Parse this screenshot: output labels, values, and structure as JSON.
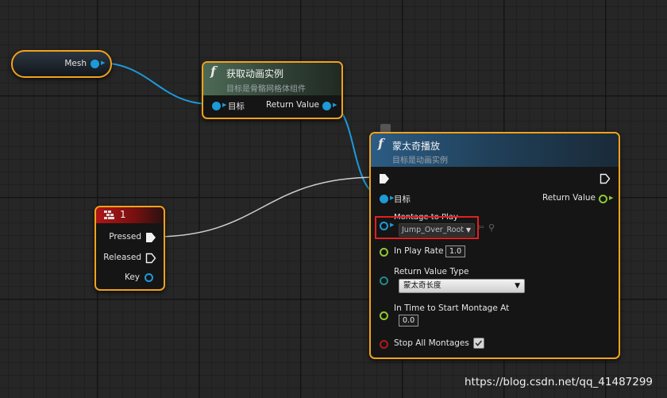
{
  "variable_node": {
    "label": "Mesh"
  },
  "get_anim_instance_node": {
    "title": "获取动画实例",
    "subtitle": "目标是骨骼网格体组件",
    "input_target_label": "目标",
    "output_return_label": "Return Value"
  },
  "input_key_node": {
    "title": "1",
    "pressed_label": "Pressed",
    "released_label": "Released",
    "key_label": "Key"
  },
  "montage_play_node": {
    "title": "蒙太奇播放",
    "subtitle": "目标是动画实例",
    "target_label": "目标",
    "return_value_label": "Return Value",
    "montage_label": "Montage to Play",
    "montage_value": "Jump_Over_Root",
    "play_rate_label": "In Play Rate",
    "play_rate_value": "1.0",
    "return_type_label": "Return Value Type",
    "return_type_value": "蒙太奇长度",
    "start_time_label": "In Time to Start Montage At",
    "start_time_value": "0.0",
    "stop_all_label": "Stop All Montages",
    "stop_all_checked": true
  },
  "colors": {
    "node_border": "#f2a21a",
    "object_pin": "#1d9ad8",
    "float_pin": "#8fc832",
    "enum_pin": "#1e8a8a",
    "bool_pin": "#b01a1a",
    "highlight": "#e02020",
    "exec_wire": "#cfcfcf"
  },
  "watermark": "https://blog.csdn.net/qq_41487299"
}
